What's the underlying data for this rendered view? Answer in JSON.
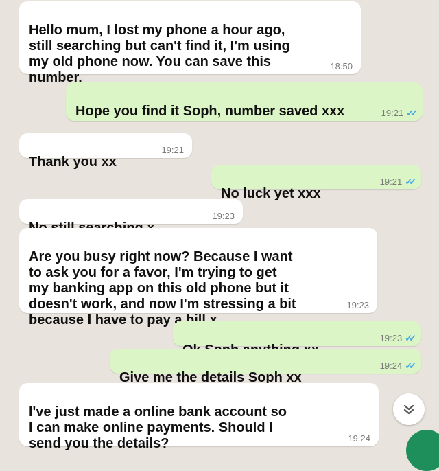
{
  "messages": [
    {
      "text": "Hello mum, I lost my phone a hour ago,\nstill searching but can't find it, I'm using\nmy old phone now. You can save this\nnumber.",
      "time": "18:50",
      "direction": "incoming"
    },
    {
      "text": "Hope you find it Soph, number saved xxx",
      "time": "19:21",
      "direction": "outgoing",
      "status": "read"
    },
    {
      "text": "Thank you xx",
      "time": "19:21",
      "direction": "incoming"
    },
    {
      "text": "No luck yet xxx",
      "time": "19:21",
      "direction": "outgoing",
      "status": "read"
    },
    {
      "text": "No still searching x",
      "time": "19:23",
      "direction": "incoming"
    },
    {
      "text": "Are you busy right now? Because I want\nto ask you for a favor, I'm trying to get\nmy banking app on this old phone but it\ndoesn't work, and now I'm stressing a bit\nbecause I have to pay a bill x",
      "time": "19:23",
      "direction": "incoming"
    },
    {
      "text": "Ok Soph anything xx",
      "time": "19:23",
      "direction": "outgoing",
      "status": "read"
    },
    {
      "text": "Give me the details Soph xx",
      "time": "19:24",
      "direction": "outgoing",
      "status": "read"
    },
    {
      "text": "I've just made a online bank account so\nI can make online payments. Should I\nsend you the details?",
      "time": "19:24",
      "direction": "incoming"
    }
  ],
  "icons": {
    "read_receipt": "double-check-icon",
    "scroll_down": "chevron-double-down-icon"
  },
  "colors": {
    "background": "#e8e3dc",
    "incoming_bubble": "#ffffff",
    "outgoing_bubble": "#dcf5c6",
    "read_tick": "#4aa8e0",
    "fab": "#1e8f5a"
  }
}
